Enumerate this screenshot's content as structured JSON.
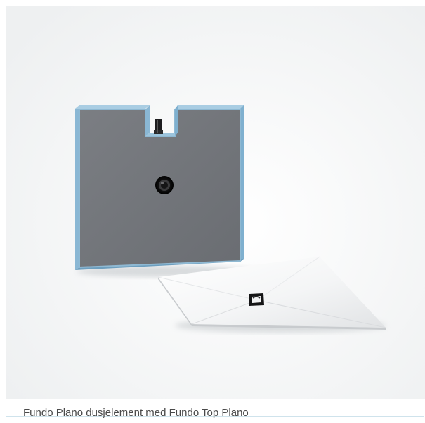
{
  "figure": {
    "caption": "Fundo Plano dusjelement med Fundo Top Plano",
    "image_subject": "shower-element-product-render"
  }
}
